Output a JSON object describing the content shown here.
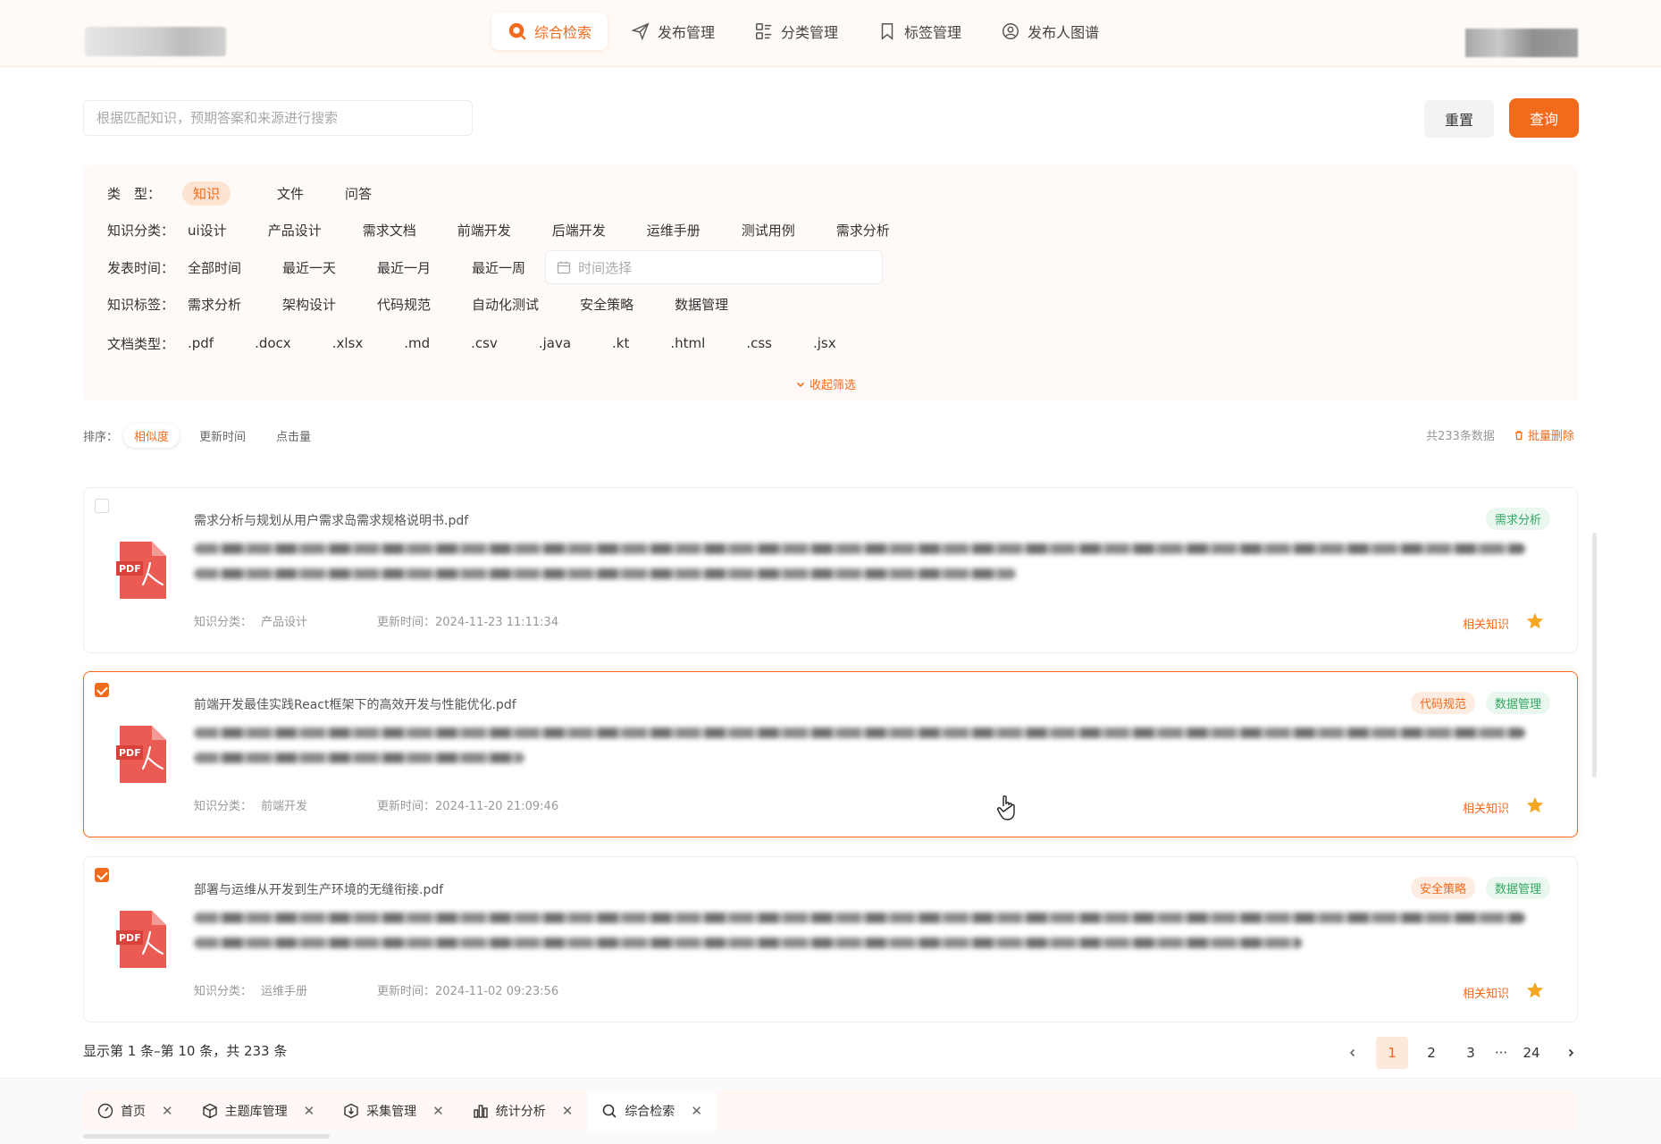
{
  "nav": [
    {
      "label": "综合检索",
      "icon": "search-circle-icon",
      "active": true
    },
    {
      "label": "发布管理",
      "icon": "paper-plane-icon"
    },
    {
      "label": "分类管理",
      "icon": "category-list-icon"
    },
    {
      "label": "标签管理",
      "icon": "bookmark-icon"
    },
    {
      "label": "发布人图谱",
      "icon": "people-graph-icon"
    }
  ],
  "search": {
    "placeholder": "根据匹配知识，预期答案和来源进行搜索",
    "value": ""
  },
  "buttons": {
    "reset": "重置",
    "query": "查询"
  },
  "filters": {
    "type": {
      "label": "类　型：",
      "options": [
        "知识",
        "文件",
        "问答"
      ],
      "active": 0
    },
    "category": {
      "label": "知识分类：",
      "options": [
        "ui设计",
        "产品设计",
        "需求文档",
        "前端开发",
        "后端开发",
        "运维手册",
        "测试用例",
        "需求分析"
      ]
    },
    "time": {
      "label": "发表时间：",
      "options": [
        "全部时间",
        "最近一天",
        "最近一月",
        "最近一周"
      ],
      "picker_placeholder": "时间选择"
    },
    "tags": {
      "label": "知识标签：",
      "options": [
        "需求分析",
        "架构设计",
        "代码规范",
        "自动化测试",
        "安全策略",
        "数据管理"
      ]
    },
    "doctype": {
      "label": "文档类型：",
      "options": [
        ".pdf",
        ".docx",
        ".xlsx",
        ".md",
        ".csv",
        ".java",
        ".kt",
        ".html",
        ".css",
        ".jsx"
      ]
    },
    "collapse_label": "收起筛选"
  },
  "sort": {
    "label": "排序：",
    "options": [
      "相似度",
      "更新时间",
      "点击量"
    ],
    "active": 0
  },
  "total_text": "共233条数据",
  "batch_delete": "批量删除",
  "results": [
    {
      "title": "需求分析与规划从用户需求岛需求规格说明书.pdf",
      "category_label": "知识分类：",
      "category": "产品设计",
      "updated": "更新时间：2024-11-23 11:11:34",
      "tags": [
        {
          "text": "需求分析",
          "color": "green"
        }
      ],
      "checked": false,
      "selected": false,
      "related": "相关知识"
    },
    {
      "title": "前端开发最佳实践React框架下的高效开发与性能优化.pdf",
      "category_label": "知识分类：",
      "category": "前端开发",
      "updated": "更新时间：2024-11-20 21:09:46",
      "tags": [
        {
          "text": "代码规范",
          "color": "orange"
        },
        {
          "text": "数据管理",
          "color": "green"
        }
      ],
      "checked": true,
      "selected": true,
      "related": "相关知识"
    },
    {
      "title": "部署与运维从开发到生产环境的无缝衔接.pdf",
      "category_label": "知识分类：",
      "category": "运维手册",
      "updated": "更新时间：2024-11-02 09:23:56",
      "tags": [
        {
          "text": "安全策略",
          "color": "orange"
        },
        {
          "text": "数据管理",
          "color": "green"
        }
      ],
      "checked": true,
      "selected": false,
      "related": "相关知识"
    }
  ],
  "pager": {
    "info": "显示第 1 条–第 10 条，共 233 条",
    "pages": [
      "1",
      "2",
      "3",
      "···",
      "24"
    ],
    "active": 0
  },
  "bottom_tabs": [
    {
      "label": "首页",
      "icon": "home-gauge-icon"
    },
    {
      "label": "主题库管理",
      "icon": "cube-icon"
    },
    {
      "label": "采集管理",
      "icon": "collect-box-icon"
    },
    {
      "label": "统计分析",
      "icon": "bar-chart-icon"
    },
    {
      "label": "综合检索",
      "icon": "search-icon",
      "active": true
    }
  ],
  "colors": {
    "accent": "#f26b1d",
    "tag_green": "#34a864",
    "star": "#f5a623"
  }
}
